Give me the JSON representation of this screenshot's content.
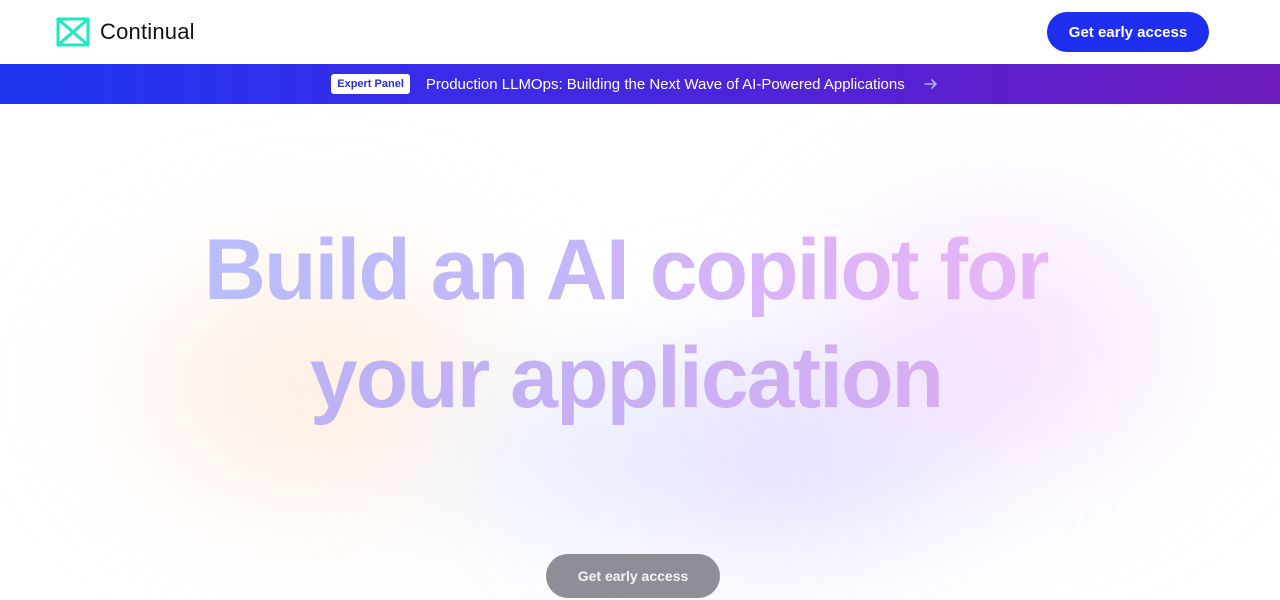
{
  "header": {
    "brand": "Continual",
    "logo_icon": "bowtie-logo-icon",
    "cta_label": "Get early access"
  },
  "announcement": {
    "badge": "Expert Panel",
    "text": "Production LLMOps: Building the Next Wave of AI-Powered Applications",
    "arrow_icon": "arrow-right-icon"
  },
  "hero": {
    "headline_line1": "Build an AI copilot for",
    "headline_line2": "your application",
    "cta_label": "Get early access"
  },
  "colors": {
    "brand_teal": "#1ee8c0",
    "primary_button": "#1f2ff0",
    "announce_start": "#1d36f2",
    "announce_end": "#6c1bb8",
    "hero_button": "#8e8e96"
  }
}
